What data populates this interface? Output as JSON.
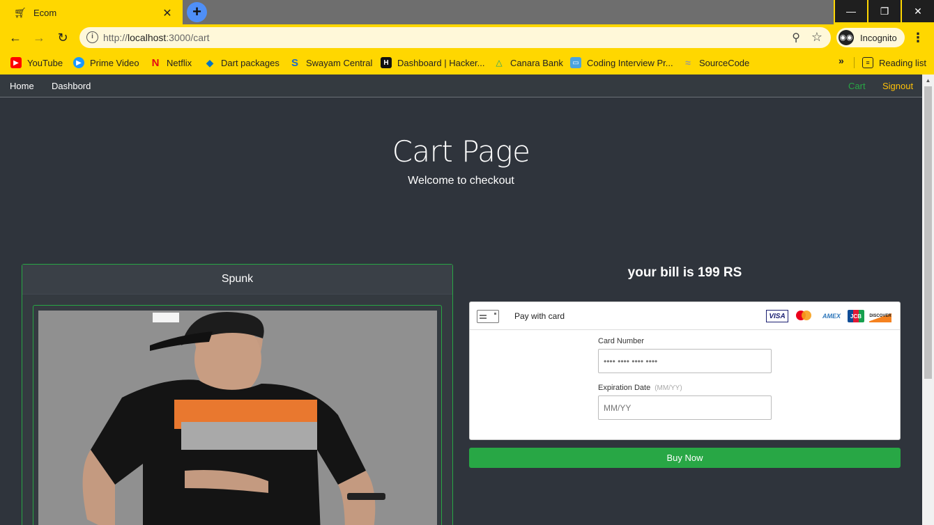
{
  "browser": {
    "tab_title": "Ecom",
    "tab_close": "✕",
    "new_tab": "+",
    "window_buttons": [
      "—",
      "❐",
      "✕"
    ],
    "url_prefix": "http://",
    "url_host": "localhost",
    "url_path": ":3000/cart",
    "incognito_label": "Incognito",
    "bookmarks": [
      {
        "label": "YouTube",
        "color": "#ff0000",
        "icon": "▶"
      },
      {
        "label": "Prime Video",
        "color": "#1a98ff",
        "icon": "▶"
      },
      {
        "label": "Netflix",
        "color": "#e50914",
        "icon": "N"
      },
      {
        "label": "Dart packages",
        "color": "#0175c2",
        "icon": "◆"
      },
      {
        "label": "Swayam Central",
        "color": "#1b6ac9",
        "icon": "S"
      },
      {
        "label": "Dashboard | Hacker...",
        "color": "#111111",
        "icon": "H"
      },
      {
        "label": "Canara Bank",
        "color": "#00a0e3",
        "icon": "△"
      },
      {
        "label": "Coding Interview Pr...",
        "color": "#4aa3df",
        "icon": "▭"
      },
      {
        "label": "SourceCode",
        "color": "#cccccc",
        "icon": "≈"
      }
    ],
    "bookmarks_more": "»",
    "reading_list": "Reading list"
  },
  "navbar": {
    "home": "Home",
    "dashboard": "Dashbord",
    "cart": "Cart",
    "signout": "Signout"
  },
  "hero": {
    "title": "Cart Page",
    "subtitle": "Welcome to checkout"
  },
  "product": {
    "name": "Spunk"
  },
  "bill": {
    "text": "your bill is 199 RS"
  },
  "payment": {
    "title": "Pay with card",
    "brands": [
      "VISA",
      "MasterCard",
      "AMEX",
      "JCB",
      "DISCOVER"
    ],
    "card_number_label": "Card Number",
    "card_number_placeholder": "•••• •••• •••• ••••",
    "expiry_label": "Expiration Date",
    "expiry_hint": "(MM/YY)",
    "expiry_placeholder": "MM/YY"
  },
  "buy_button": "Buy Now",
  "colors": {
    "chrome": "#ffd700",
    "page_bg": "#2f343c",
    "success": "#28a745",
    "warning": "#ffc107"
  }
}
